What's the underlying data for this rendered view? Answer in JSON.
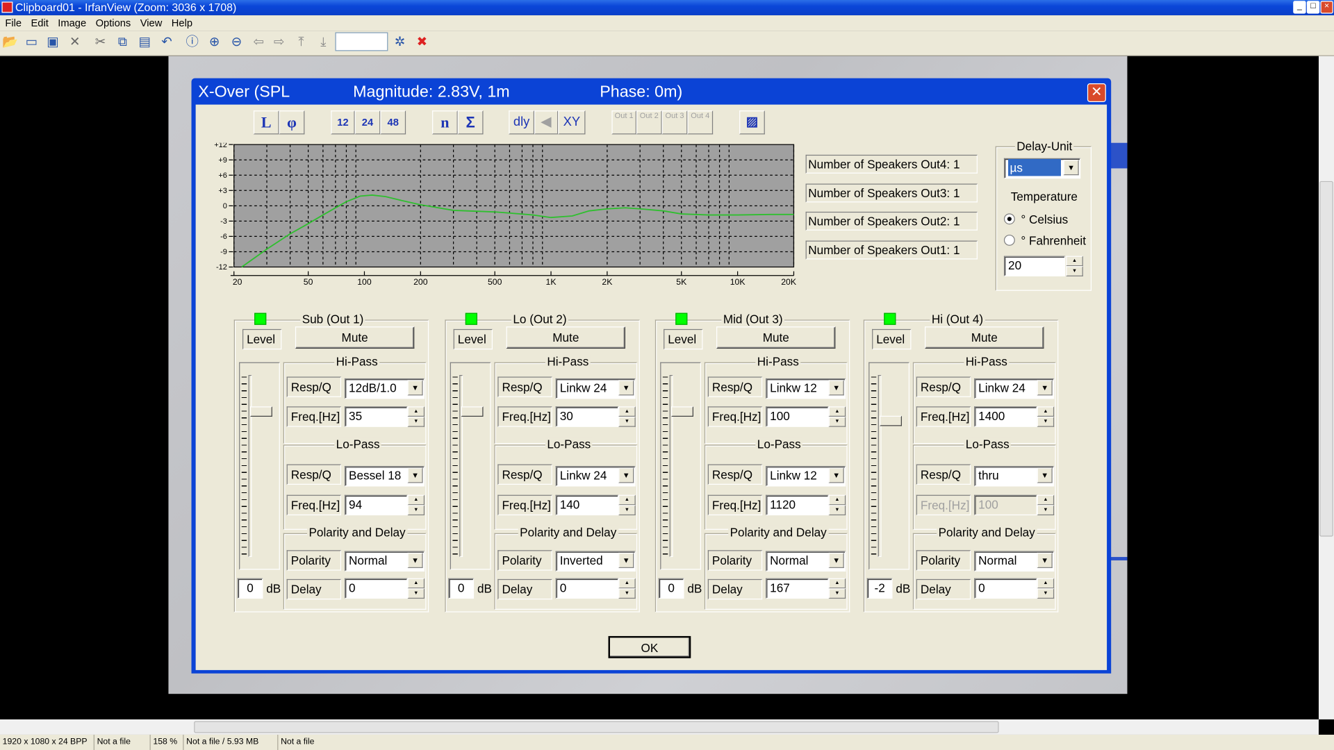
{
  "app": {
    "title": "Clipboard01 - IrfanView (Zoom: 3036 x 1708)",
    "menu": [
      "File",
      "Edit",
      "Image",
      "Options",
      "View",
      "Help"
    ],
    "statusbar": [
      "1920 x 1080 x 24 BPP",
      "Not a file",
      "158 %",
      "Not a file / 5.93 MB",
      "Not a file"
    ]
  },
  "dialog": {
    "title_main": "X-Over (SPL",
    "title_magnitude": "Magnitude: 2.83V, 1m",
    "title_phase": "Phase: 0m)",
    "toolbar": {
      "l_label": "L",
      "phi_label": "φ",
      "slope12": "12",
      "slope24": "24",
      "slope48": "48",
      "n_label": "n",
      "sum_label": "Σ",
      "dly_label": "dly",
      "xy_label": "XY",
      "out1": "Out 1",
      "out2": "Out 2",
      "out3": "Out 3",
      "out4": "Out 4"
    },
    "speakers": {
      "out4": "Number of Speakers Out4: 1",
      "out3": "Number of Speakers Out3: 1",
      "out2": "Number of Speakers Out2: 1",
      "out1": "Number of Speakers Out1: 1"
    },
    "settings": {
      "delay_unit_label": "Delay-Unit",
      "delay_unit_value": "µs",
      "temperature_label": "Temperature",
      "celsius_label": "° Celsius",
      "fahrenheit_label": "° Fahrenheit",
      "temperature_value": "20",
      "celsius_selected": true
    },
    "ok_label": "OK",
    "common": {
      "level": "Level",
      "mute": "Mute",
      "hipass": "Hi-Pass",
      "lopass": "Lo-Pass",
      "resp": "Resp/Q",
      "freq": "Freq.[Hz]",
      "polarity_delay": "Polarity and Delay",
      "polarity": "Polarity",
      "delay": "Delay",
      "db": "dB"
    },
    "channels": [
      {
        "name": "Sub (Out 1)",
        "level": "0",
        "hp_resp": "12dB/1.0",
        "hp_freq": "35",
        "lp_resp": "Bessel 18",
        "lp_freq": "94",
        "polarity": "Normal",
        "delay": "0",
        "slider_level": 0.2
      },
      {
        "name": "Lo (Out 2)",
        "level": "0",
        "hp_resp": "Linkw 24",
        "hp_freq": "30",
        "lp_resp": "Linkw 24",
        "lp_freq": "140",
        "polarity": "Inverted",
        "delay": "0",
        "slider_level": 0.2
      },
      {
        "name": "Mid (Out 3)",
        "level": "0",
        "hp_resp": "Linkw 12",
        "hp_freq": "100",
        "lp_resp": "Linkw 12",
        "lp_freq": "1120",
        "polarity": "Normal",
        "delay": "167",
        "slider_level": 0.2
      },
      {
        "name": "Hi (Out 4)",
        "level": "-2",
        "hp_resp": "Linkw 24",
        "hp_freq": "1400",
        "lp_resp": "thru",
        "lp_freq": "100",
        "polarity": "Normal",
        "delay": "0",
        "slider_level": 0.25
      }
    ]
  },
  "chart_data": {
    "type": "line",
    "title": "",
    "xlabel": "",
    "ylabel": "",
    "xscale": "log",
    "xlim": [
      20,
      20000
    ],
    "ylim": [
      -12,
      12
    ],
    "xticks": [
      "20",
      "50",
      "100",
      "200",
      "500",
      "1K",
      "2K",
      "5K",
      "10K",
      "20K"
    ],
    "xtick_values": [
      20,
      50,
      100,
      200,
      500,
      1000,
      2000,
      5000,
      10000,
      20000
    ],
    "yticks": [
      "+12",
      "+9",
      "+6",
      "+3",
      "0",
      "-3",
      "-6",
      "-9",
      "-12"
    ],
    "ytick_values": [
      12,
      9,
      6,
      3,
      0,
      -3,
      -6,
      -9,
      -12
    ],
    "grid": true,
    "series": [
      {
        "color": "#2fbf2f",
        "x": [
          22,
          30,
          40,
          50,
          60,
          70,
          80,
          95,
          110,
          130,
          160,
          200,
          300,
          500,
          800,
          1000,
          1300,
          1600,
          2000,
          2500,
          3000,
          4000,
          5000,
          7000,
          10000,
          15000,
          20000
        ],
        "y": [
          -12,
          -8.5,
          -5.5,
          -3.5,
          -1.8,
          -0.4,
          0.8,
          1.9,
          2.1,
          1.8,
          1.0,
          0.2,
          -0.9,
          -1.2,
          -1.8,
          -2.3,
          -2.0,
          -1.0,
          -0.6,
          -0.4,
          -0.6,
          -1.0,
          -1.6,
          -1.8,
          -1.8,
          -1.7,
          -1.7
        ]
      }
    ],
    "colors": {
      "plot_bg": "#a0a0a0",
      "grid": "#000000"
    }
  }
}
